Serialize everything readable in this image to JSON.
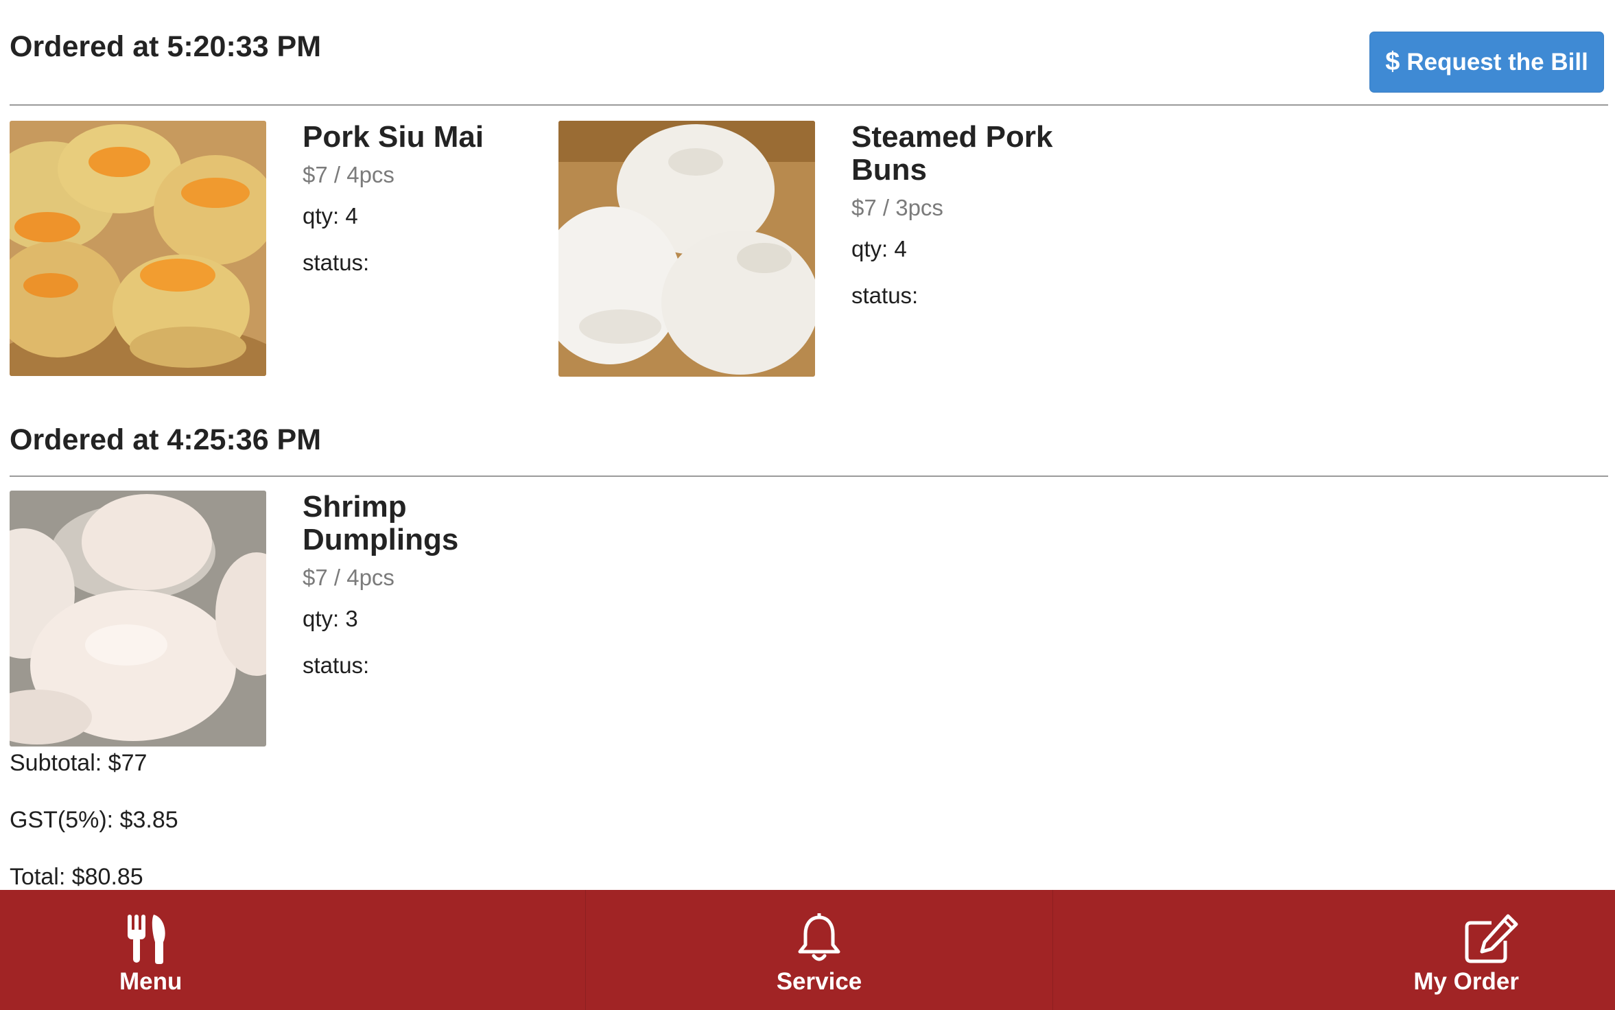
{
  "header": {
    "bill_button_icon": "dollar-icon",
    "bill_button_label": "Request the Bill",
    "bill_button_color": "#3f8ad4"
  },
  "orders": [
    {
      "title": "Ordered at 5:20:33 PM",
      "items": [
        {
          "name": "Pork Siu Mai",
          "price": "$7 / 4pcs",
          "qty": "qty: 4",
          "status": "status:",
          "image": "siu-mai-photo"
        },
        {
          "name": "Steamed Pork Buns",
          "price": "$7 / 3pcs",
          "qty": "qty: 4",
          "status": "status:",
          "image": "pork-bun-photo"
        }
      ]
    },
    {
      "title": "Ordered at 4:25:36 PM",
      "items": [
        {
          "name": "Shrimp Dumplings",
          "price": "$7 / 4pcs",
          "qty": "qty: 3",
          "status": "status:",
          "image": "shrimp-dumpling-photo"
        }
      ]
    }
  ],
  "totals": {
    "subtotal": "Subtotal: $77",
    "gst": "GST(5%): $3.85",
    "total": "Total: $80.85"
  },
  "nav": {
    "background": "#a12425",
    "items": [
      {
        "label": "Menu",
        "icon": "utensils-icon"
      },
      {
        "label": "Service",
        "icon": "bell-icon"
      },
      {
        "label": "My Order",
        "icon": "edit-icon"
      }
    ]
  }
}
